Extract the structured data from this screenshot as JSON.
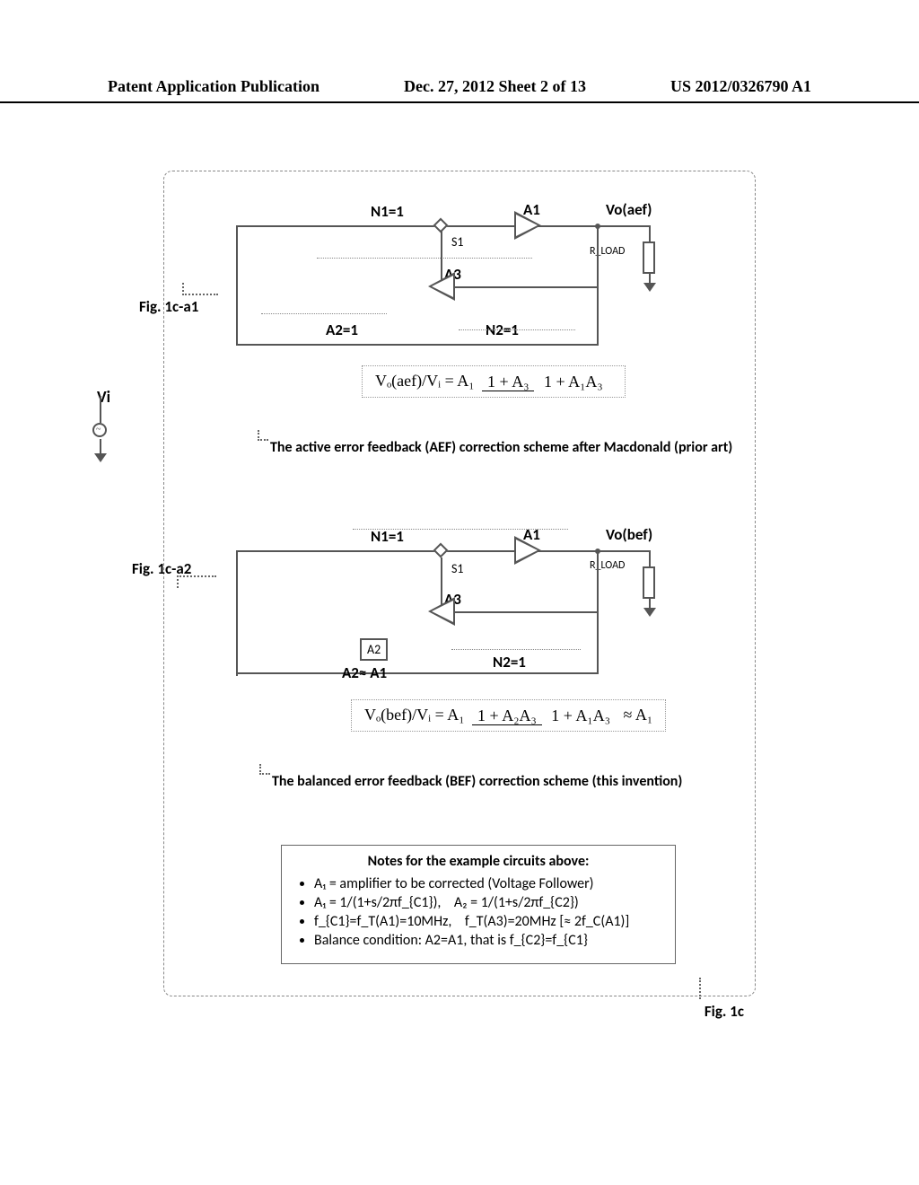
{
  "header": {
    "left": "Patent Application Publication",
    "center": "Dec. 27, 2012  Sheet 2 of 13",
    "right": "US 2012/0326790 A1"
  },
  "vi": "Vi",
  "fig_a1": {
    "label": "Fig. 1c-a1",
    "n1": "N1=1",
    "a1": "A1",
    "s1": "S1",
    "a3": "A3",
    "a2": "A2=1",
    "n2": "N2=1",
    "rload": "R_LOAD",
    "vo": "Vo(aef)",
    "eq_lhs": "Vₒ(aef)/Vᵢ = A₁",
    "eq_num": "1 + A₃",
    "eq_den": "1 + A₁A₃",
    "caption": "The active error feedback (AEF) correction scheme after Macdonald (prior art)"
  },
  "fig_a2": {
    "label": "Fig. 1c-a2",
    "n1": "N1=1",
    "a1": "A1",
    "s1": "S1",
    "a3": "A3",
    "a2box": "A2",
    "a2lbl": "A2≈ A1",
    "n2": "N2=1",
    "rload": "R_LOAD",
    "vo": "Vo(bef)",
    "eq_lhs": "Vₒ(bef)/Vᵢ = A₁",
    "eq_num": "1 + A₂A₃",
    "eq_den": "1 + A₁A₃",
    "eq_rhs": "≈ A₁",
    "caption": "The balanced error feedback (BEF) correction scheme (this invention)"
  },
  "notes": {
    "title": "Notes for the example circuits above:",
    "items": [
      "A₁ = amplifier to be corrected (Voltage Follower)",
      "A₁ = 1/(1+s/2πf_{C1}),    A₂ = 1/(1+s/2πf_{C2})",
      "f_{C1}=f_T(A1)=10MHz,    f_T(A3)=20MHz [≈ 2f_C(A1)]",
      "Balance condition: A2=A1, that is f_{C2}=f_{C1}"
    ]
  },
  "fig_main": "Fig. 1c"
}
